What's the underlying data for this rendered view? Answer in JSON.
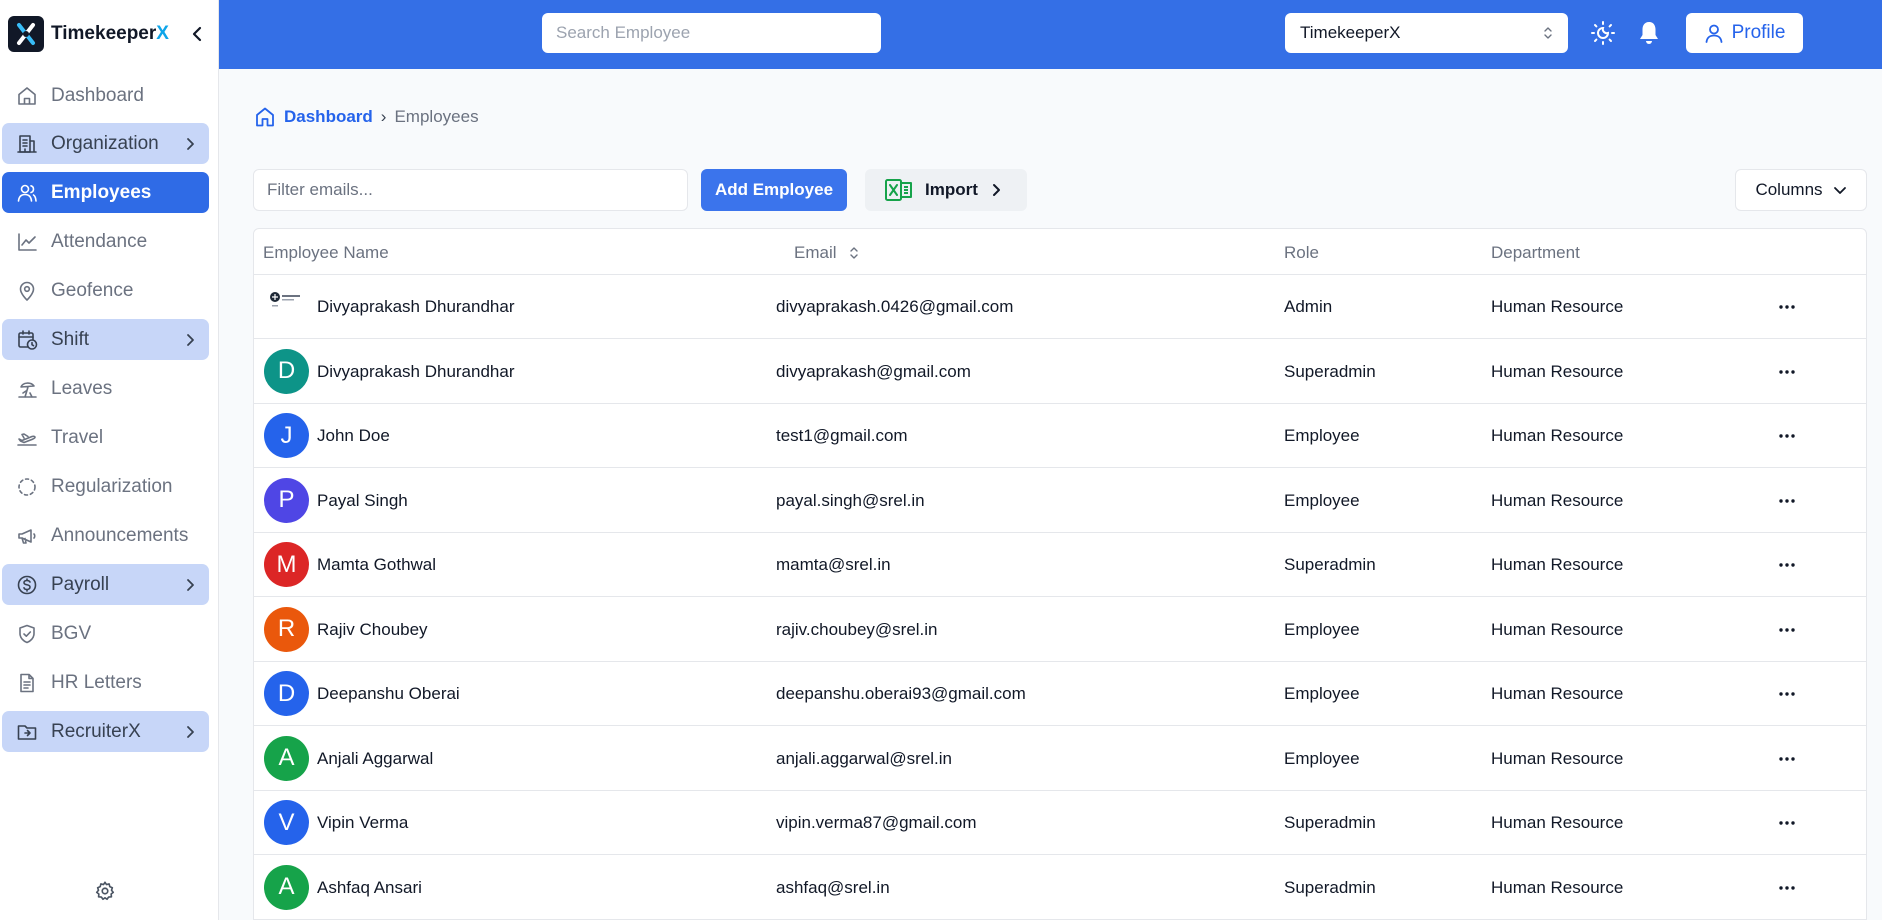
{
  "brand": {
    "name_main": "Timekeeper",
    "name_accent": "X"
  },
  "sidebar": {
    "items": [
      {
        "label": "Dashboard",
        "icon": "home-icon",
        "state": "normal"
      },
      {
        "label": "Organization",
        "icon": "building-icon",
        "state": "group"
      },
      {
        "label": "Employees",
        "icon": "users-icon",
        "state": "active"
      },
      {
        "label": "Attendance",
        "icon": "chart-line-icon",
        "state": "normal"
      },
      {
        "label": "Geofence",
        "icon": "map-pin-icon",
        "state": "normal"
      },
      {
        "label": "Shift",
        "icon": "calendar-clock-icon",
        "state": "group"
      },
      {
        "label": "Leaves",
        "icon": "beach-icon",
        "state": "normal"
      },
      {
        "label": "Travel",
        "icon": "plane-icon",
        "state": "normal"
      },
      {
        "label": "Regularization",
        "icon": "dashed-circle-icon",
        "state": "normal"
      },
      {
        "label": "Announcements",
        "icon": "megaphone-icon",
        "state": "normal"
      },
      {
        "label": "Payroll",
        "icon": "dollar-circle-icon",
        "state": "group"
      },
      {
        "label": "BGV",
        "icon": "shield-check-icon",
        "state": "normal"
      },
      {
        "label": "HR Letters",
        "icon": "document-icon",
        "state": "normal"
      },
      {
        "label": "RecruiterX",
        "icon": "folder-icon",
        "state": "group"
      }
    ]
  },
  "topbar": {
    "search_placeholder": "Search Employee",
    "org_selected": "TimekeeperX",
    "profile_label": "Profile"
  },
  "breadcrumb": {
    "home": "Dashboard",
    "current": "Employees",
    "separator": "›"
  },
  "toolbar": {
    "filter_placeholder": "Filter emails...",
    "add_label": "Add Employee",
    "import_label": "Import",
    "columns_label": "Columns"
  },
  "table": {
    "headers": {
      "name": "Employee Name",
      "email": "Email",
      "role": "Role",
      "department": "Department"
    },
    "rows": [
      {
        "initial": "",
        "avatar_type": "image",
        "color": "#ffffff",
        "name": "Divyaprakash Dhurandhar",
        "email": "divyaprakash.0426@gmail.com",
        "role": "Admin",
        "department": "Human Resource"
      },
      {
        "initial": "D",
        "avatar_type": "letter",
        "color": "#0d9488",
        "name": "Divyaprakash Dhurandhar",
        "email": "divyaprakash@gmail.com",
        "role": "Superadmin",
        "department": "Human Resource"
      },
      {
        "initial": "J",
        "avatar_type": "letter",
        "color": "#2563eb",
        "name": "John Doe",
        "email": "test1@gmail.com",
        "role": "Employee",
        "department": "Human Resource"
      },
      {
        "initial": "P",
        "avatar_type": "letter",
        "color": "#4f46e5",
        "name": "Payal Singh",
        "email": "payal.singh@srel.in",
        "role": "Employee",
        "department": "Human Resource"
      },
      {
        "initial": "M",
        "avatar_type": "letter",
        "color": "#dc2626",
        "name": "Mamta Gothwal",
        "email": "mamta@srel.in",
        "role": "Superadmin",
        "department": "Human Resource"
      },
      {
        "initial": "R",
        "avatar_type": "letter",
        "color": "#ea580c",
        "name": "Rajiv Choubey",
        "email": "rajiv.choubey@srel.in",
        "role": "Employee",
        "department": "Human Resource"
      },
      {
        "initial": "D",
        "avatar_type": "letter",
        "color": "#2563eb",
        "name": "Deepanshu Oberai",
        "email": "deepanshu.oberai93@gmail.com",
        "role": "Employee",
        "department": "Human Resource"
      },
      {
        "initial": "A",
        "avatar_type": "letter",
        "color": "#16a34a",
        "name": "Anjali Aggarwal",
        "email": "anjali.aggarwal@srel.in",
        "role": "Employee",
        "department": "Human Resource"
      },
      {
        "initial": "V",
        "avatar_type": "letter",
        "color": "#2563eb",
        "name": "Vipin Verma",
        "email": "vipin.verma87@gmail.com",
        "role": "Superadmin",
        "department": "Human Resource"
      },
      {
        "initial": "A",
        "avatar_type": "letter",
        "color": "#16a34a",
        "name": "Ashfaq Ansari",
        "email": "ashfaq@srel.in",
        "role": "Superadmin",
        "department": "Human Resource"
      }
    ]
  },
  "colors": {
    "primary": "#346fe6",
    "active_nav": "#2f6be6",
    "group_nav": "#c7d6f8",
    "excel_green": "#16a34a"
  }
}
